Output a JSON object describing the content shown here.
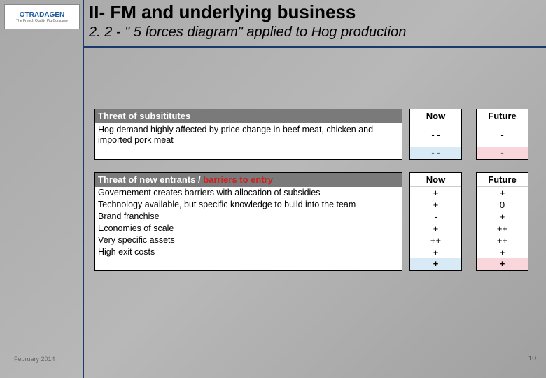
{
  "logo": {
    "name": "OTRADAGEN",
    "tagline": "The French Quality Pig Company"
  },
  "header": {
    "title": "II-   FM and underlying business",
    "subtitle": "2. 2 - \" 5 forces diagram\" applied to Hog production"
  },
  "columns": {
    "now": "Now",
    "future": "Future"
  },
  "block1": {
    "heading": "Threat of subsititutes",
    "rows": [
      {
        "text": "Hog demand highly affected by price change in beef meat, chicken and imported pork meat",
        "now": "- -",
        "future": "-"
      }
    ],
    "summary": {
      "now": "- -",
      "future": "-"
    }
  },
  "block2": {
    "heading_a": "Threat of new entrants / ",
    "heading_b": "barriers to entry",
    "rows": [
      {
        "text": "Governement creates barriers with allocation of subsidies",
        "now": "+",
        "future": "+"
      },
      {
        "text": "Technology available, but specific knowledge to build into the team",
        "now": "+",
        "future": "0"
      },
      {
        "text": "Brand franchise",
        "now": "-",
        "future": "+"
      },
      {
        "text": "Economies of scale",
        "now": "+",
        "future": "++"
      },
      {
        "text": "Very specific assets",
        "now": "++",
        "future": "++"
      },
      {
        "text": "High exit costs",
        "now": "+",
        "future": "+"
      }
    ],
    "summary": {
      "now": "+",
      "future": "+"
    }
  },
  "footer": {
    "date": "February 2014",
    "page": "10"
  }
}
